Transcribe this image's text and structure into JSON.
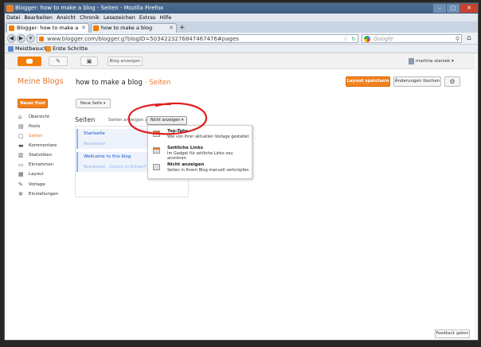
{
  "window": {
    "title": "Blogger: how to make a blog - Seiten - Mozilla Firefox"
  },
  "menubar": [
    "Datei",
    "Bearbeiten",
    "Ansicht",
    "Chronik",
    "Lesezeichen",
    "Extras",
    "Hilfe"
  ],
  "tabs": [
    {
      "label": "Blogger: how to make a blog -..."
    },
    {
      "label": "how to make a blog"
    }
  ],
  "navbar": {
    "url": "www.blogger.com/blogger.g?blogID=5034223276847467476#pages",
    "search_placeholder": "Google"
  },
  "bookmarks": [
    {
      "label": "Meistbesucht"
    },
    {
      "label": "Erste Schritte"
    }
  ],
  "blogger": {
    "view_blog": "Blog anzeigen",
    "user": "martina staniek",
    "brand": "Meine Blogs",
    "blog_title": "how to make a blog",
    "separator": "·",
    "page_name": "Seiten",
    "save_label": "Layout speichern",
    "discard_label": "Änderungen löschen",
    "new_post": "Neuer Post",
    "nav": [
      {
        "label": "Übersicht",
        "icon": "home-icon",
        "glyph": "⌂"
      },
      {
        "label": "Posts",
        "icon": "posts-icon",
        "glyph": "▤"
      },
      {
        "label": "Seiten",
        "icon": "pages-icon",
        "glyph": "▢"
      },
      {
        "label": "Kommentare",
        "icon": "comments-icon",
        "glyph": "▬"
      },
      {
        "label": "Statistiken",
        "icon": "stats-icon",
        "glyph": "▥"
      },
      {
        "label": "Einnahmen",
        "icon": "earnings-icon",
        "glyph": "▭"
      },
      {
        "label": "Layout",
        "icon": "layout-icon",
        "glyph": "▦"
      },
      {
        "label": "Vorlage",
        "icon": "template-icon",
        "glyph": "✎"
      },
      {
        "label": "Einstellungen",
        "icon": "settings-icon",
        "glyph": "✲"
      }
    ],
    "new_page": "Neue Seite",
    "pages_heading": "Seiten",
    "show_as": "Seiten anzeigen als",
    "dropdown_value": "Nicht anzeigen",
    "page_list": [
      {
        "title": "Startseite",
        "actions": "Bearbeiten"
      },
      {
        "title": "Wellcome to this blog",
        "actions": "Bearbeiten . Zurück zu Entwurf . Lö"
      }
    ],
    "menu": [
      {
        "title": "Top-Tabs",
        "desc": "Wie von Ihrer aktuellen Vorlage gestaltet"
      },
      {
        "title": "Seitliche Links",
        "desc": "Im Gadget für seitliche Links neu anordnen"
      },
      {
        "title": "Nicht anzeigen",
        "desc": "Seiten in Ihrem Blog manuell verknüpfen"
      }
    ],
    "feedback": "Feedback geben"
  }
}
